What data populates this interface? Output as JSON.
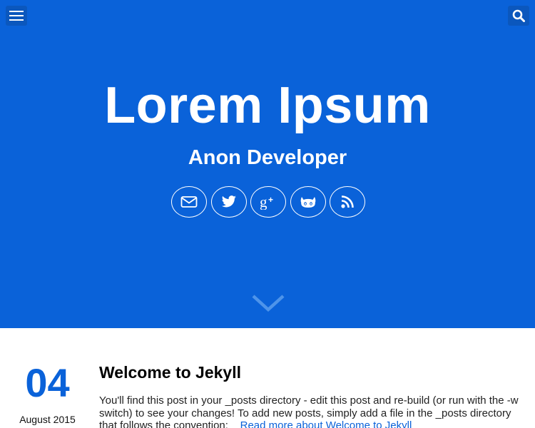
{
  "header": {
    "menu_icon": "hamburger-menu-icon",
    "search_icon": "search-icon",
    "title": "Lorem Ipsum",
    "subtitle": "Anon Developer",
    "social": [
      {
        "icon": "mail-icon"
      },
      {
        "icon": "twitter-icon"
      },
      {
        "icon": "google-plus-icon"
      },
      {
        "icon": "github-icon"
      },
      {
        "icon": "rss-icon"
      }
    ],
    "scroll_icon": "chevron-down-icon"
  },
  "post": {
    "day": "04",
    "month_year": "August 2015",
    "title": "Welcome to Jekyll",
    "excerpt": "You'll find this post in your _posts directory - edit this post and re-build (or run with the -w switch) to see your changes! To add new posts, simply add a file in the _posts directory that follows the convention:",
    "read_more": "Read more about Welcome to Jekyll"
  },
  "colors": {
    "hero_background": "#0a62d9",
    "corner_button": "#0b57bd",
    "accent": "#0a62d9",
    "text": "#000000"
  }
}
